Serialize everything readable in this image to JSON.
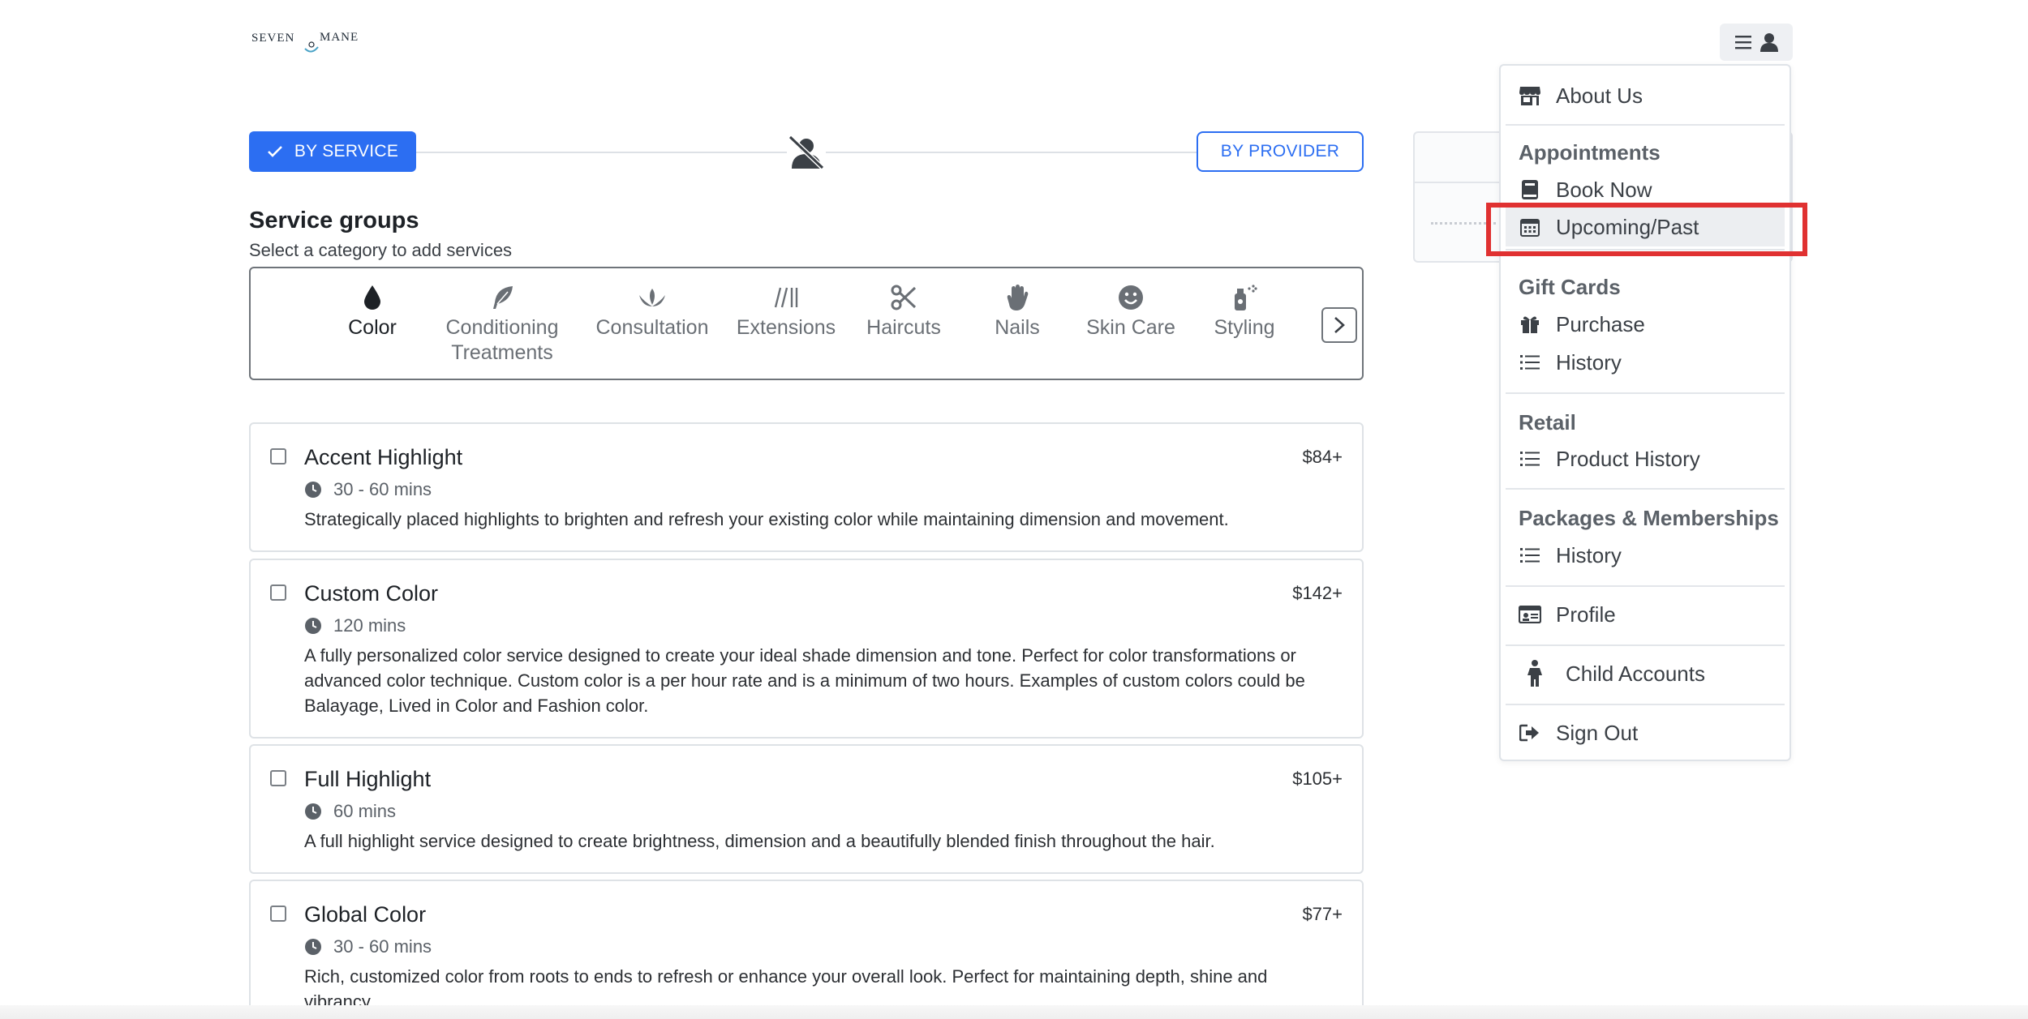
{
  "brand": {
    "logo_text_left": "SEVEN",
    "logo_text_right": "MANE"
  },
  "stepper": {
    "by_service_label": "BY SERVICE",
    "by_provider_label": "BY PROVIDER"
  },
  "service_groups": {
    "title": "Service groups",
    "subtitle": "Select a category to add services",
    "categories": [
      {
        "label": "Color",
        "icon": "drop-icon",
        "active": true
      },
      {
        "label": "Conditioning Treatments",
        "icon": "feather-icon",
        "active": false
      },
      {
        "label": "Consultation",
        "icon": "lotus-icon",
        "active": false
      },
      {
        "label": "Extensions",
        "icon": "hair-strands-icon",
        "active": false
      },
      {
        "label": "Haircuts",
        "icon": "scissors-icon",
        "active": false
      },
      {
        "label": "Nails",
        "icon": "hand-icon",
        "active": false
      },
      {
        "label": "Skin Care",
        "icon": "smile-icon",
        "active": false
      },
      {
        "label": "Styling",
        "icon": "spray-icon",
        "active": false
      }
    ]
  },
  "services": [
    {
      "name": "Accent Highlight",
      "price": "$84+",
      "duration": "30 - 60 mins",
      "description": "Strategically placed highlights to brighten and refresh your existing color while maintaining dimension and movement."
    },
    {
      "name": "Custom Color",
      "price": "$142+",
      "duration": "120 mins",
      "description": "A fully personalized color service designed to create your ideal shade dimension and tone. Perfect for color transformations or advanced color technique. Custom color is a per hour rate and is a minimum of two hours. Examples of custom colors could be Balayage, Lived in Color and Fashion color."
    },
    {
      "name": "Full Highlight",
      "price": "$105+",
      "duration": "60 mins",
      "description": "A full highlight service designed to create brightness, dimension and a beautifully blended finish throughout the hair."
    },
    {
      "name": "Global Color",
      "price": "$77+",
      "duration": "30 - 60 mins",
      "description": "Rich, customized color from roots to ends to refresh or enhance your overall look. Perfect for maintaining depth, shine and vibrancy."
    }
  ],
  "menu": {
    "about": "About Us",
    "appointments_heading": "Appointments",
    "book_now": "Book Now",
    "upcoming_past": "Upcoming/Past",
    "gift_cards_heading": "Gift Cards",
    "purchase": "Purchase",
    "gift_history": "History",
    "retail_heading": "Retail",
    "product_history": "Product History",
    "packages_heading": "Packages & Memberships",
    "packages_history": "History",
    "profile": "Profile",
    "child_accounts": "Child Accounts",
    "sign_out": "Sign Out"
  },
  "colors": {
    "accent": "#2c6ef2",
    "highlight_box": "#e03131"
  }
}
